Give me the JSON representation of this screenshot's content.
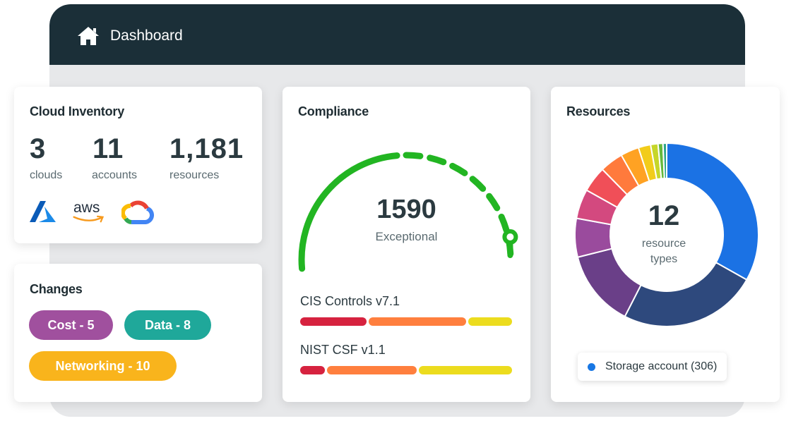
{
  "header": {
    "title": "Dashboard",
    "icon": "home-icon"
  },
  "inventory": {
    "title": "Cloud Inventory",
    "stats": [
      {
        "value": "3",
        "label": "clouds"
      },
      {
        "value": "11",
        "label": "accounts"
      },
      {
        "value": "1,181",
        "label": "resources"
      }
    ],
    "providers": [
      "azure-logo",
      "aws-logo",
      "google-cloud-logo"
    ],
    "aws_text": "aws"
  },
  "changes": {
    "title": "Changes",
    "tags": [
      {
        "label": "Cost - 5",
        "color": "#a0509e"
      },
      {
        "label": "Data - 8",
        "color": "#1fa89a"
      },
      {
        "label": "Networking - 10",
        "color": "#f9b41c"
      }
    ]
  },
  "compliance": {
    "title": "Compliance",
    "score": "1590",
    "rating": "Exceptional",
    "gauge_color": "#22b522",
    "frameworks": [
      {
        "name": "CIS Controls v7.1",
        "segments": [
          {
            "fraction": 0.32,
            "color": "#d6223f"
          },
          {
            "fraction": 0.47,
            "color": "#ff7f3e"
          },
          {
            "fraction": 0.21,
            "color": "#ecdc1e"
          }
        ]
      },
      {
        "name": "NIST CSF v1.1",
        "segments": [
          {
            "fraction": 0.12,
            "color": "#d6223f"
          },
          {
            "fraction": 0.43,
            "color": "#ff7f3e"
          },
          {
            "fraction": 0.45,
            "color": "#ecdc1e"
          }
        ]
      }
    ]
  },
  "resources": {
    "title": "Resources",
    "count": "12",
    "count_label_line1": "resource",
    "count_label_line2": "types",
    "legend_label": "Storage account (306)",
    "slices": [
      {
        "value": 306,
        "color": "#1b72e4"
      },
      {
        "value": 225,
        "color": "#2e497d"
      },
      {
        "value": 125,
        "color": "#6a3f88"
      },
      {
        "value": 63,
        "color": "#9a4b9d"
      },
      {
        "value": 48,
        "color": "#d3497f"
      },
      {
        "value": 42,
        "color": "#f04f58"
      },
      {
        "value": 38,
        "color": "#ff7a3c"
      },
      {
        "value": 30,
        "color": "#ffa223"
      },
      {
        "value": 20,
        "color": "#f2cc1a"
      },
      {
        "value": 12,
        "color": "#c6d629"
      },
      {
        "value": 8,
        "color": "#65b83c"
      },
      {
        "value": 6,
        "color": "#2ea58b"
      }
    ]
  }
}
